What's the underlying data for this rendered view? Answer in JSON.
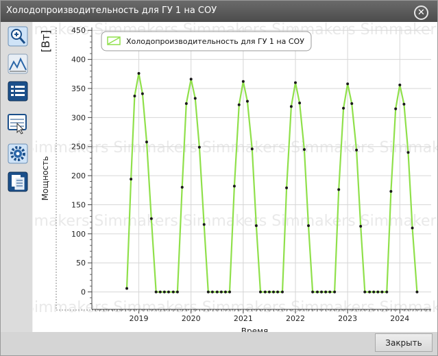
{
  "window": {
    "title": "Холодопроизводительность для ГУ 1 на СОУ"
  },
  "toolbar": {
    "icons": [
      "zoom-icon",
      "mountains-icon",
      "list-icon",
      "table-pointer-icon",
      "gear-icon",
      "copy-icon"
    ]
  },
  "watermark": "Simmakers",
  "footer": {
    "close_label": "Закрыть"
  },
  "chart_data": {
    "type": "line",
    "title": "",
    "ylabel": "Мощность",
    "yunit": "[Вт]",
    "xlabel": "Время",
    "ylim": [
      -30,
      455
    ],
    "yticks": [
      0,
      50,
      100,
      150,
      200,
      250,
      300,
      350,
      400,
      450
    ],
    "xlim": [
      2018.1,
      2024.6
    ],
    "xticks": [
      2019,
      2020,
      2021,
      2022,
      2023,
      2024
    ],
    "grid": true,
    "legend_position": "top-left",
    "color": "#8fe04a",
    "series": [
      {
        "name": "Холодопроизводительность для ГУ 1 на СОУ",
        "x": [
          2018.77,
          2018.85,
          2018.92,
          2019.0,
          2019.07,
          2019.15,
          2019.24,
          2019.33,
          2019.41,
          2019.49,
          2019.57,
          2019.66,
          2019.74,
          2019.83,
          2019.91,
          2020.0,
          2020.08,
          2020.16,
          2020.25,
          2020.33,
          2020.41,
          2020.5,
          2020.58,
          2020.66,
          2020.74,
          2020.83,
          2020.92,
          2021.0,
          2021.08,
          2021.17,
          2021.25,
          2021.33,
          2021.42,
          2021.5,
          2021.58,
          2021.66,
          2021.75,
          2021.83,
          2021.92,
          2022.0,
          2022.08,
          2022.17,
          2022.25,
          2022.33,
          2022.42,
          2022.5,
          2022.58,
          2022.66,
          2022.75,
          2022.83,
          2022.92,
          2023.0,
          2023.08,
          2023.17,
          2023.25,
          2023.33,
          2023.42,
          2023.5,
          2023.58,
          2023.66,
          2023.75,
          2023.83,
          2023.92,
          2024.0,
          2024.08,
          2024.16,
          2024.24,
          2024.33
        ],
        "y": [
          6,
          194,
          337,
          376,
          341,
          258,
          126,
          0,
          0,
          0,
          0,
          0,
          0,
          180,
          324,
          366,
          333,
          249,
          116,
          0,
          0,
          0,
          0,
          0,
          0,
          182,
          322,
          362,
          328,
          246,
          114,
          0,
          0,
          0,
          0,
          0,
          0,
          179,
          319,
          360,
          325,
          245,
          114,
          0,
          0,
          0,
          0,
          0,
          0,
          176,
          316,
          358,
          324,
          244,
          113,
          0,
          0,
          0,
          0,
          0,
          0,
          173,
          315,
          356,
          323,
          240,
          110,
          0
        ]
      }
    ]
  }
}
